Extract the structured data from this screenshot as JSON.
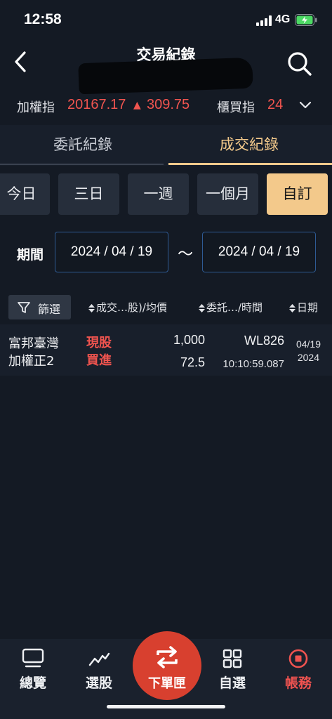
{
  "status_bar": {
    "time": "12:58",
    "network": "4G"
  },
  "header": {
    "title": "交易紀錄"
  },
  "ticker": {
    "taiex_label": "加權指",
    "taiex_value": "20167.17",
    "taiex_arrow": "▲",
    "taiex_change": "309.75",
    "otc_label": "櫃買指",
    "otc_value": "24"
  },
  "tabs": {
    "commission": "委託紀錄",
    "trade": "成交紀錄"
  },
  "ranges": {
    "today": "今日",
    "three_days": "三日",
    "week": "一週",
    "month": "一個月",
    "custom": "自訂"
  },
  "period": {
    "label": "期間",
    "start": "2024 / 04 / 19",
    "separator": "～",
    "end": "2024 / 04 / 19"
  },
  "filter": {
    "label": "篩選"
  },
  "columns": {
    "col1": "成交…股)/均價",
    "col2": "委託…/時間",
    "col3": "日期"
  },
  "rows": [
    {
      "name_line1": "富邦臺灣",
      "name_line2": "加權正2",
      "type_line1": "現股",
      "type_line2": "買進",
      "quantity": "1,000",
      "price": "72.5",
      "order_no": "WL826",
      "time": "10:10:59.087",
      "date_md": "04/19",
      "date_year": "2024"
    }
  ],
  "nav": {
    "overview": "總覽",
    "picker": "選股",
    "order": "下單匣",
    "watchlist": "自選",
    "account": "帳務"
  },
  "colors": {
    "accent_gold": "#f3c98b",
    "up_red": "#f0544f",
    "order_red": "#d8402f"
  }
}
